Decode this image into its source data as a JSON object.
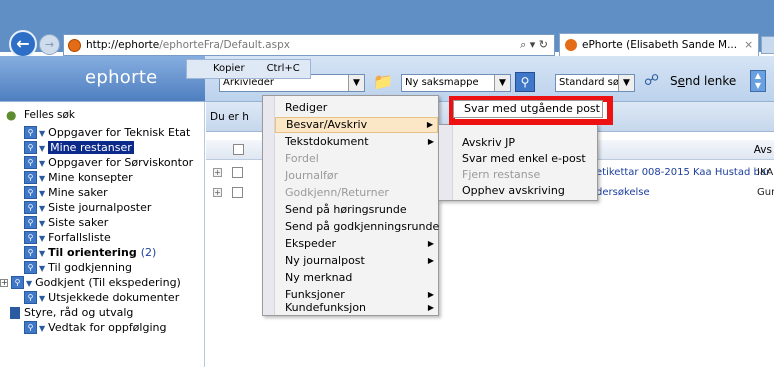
{
  "browser": {
    "url_host": "http://ephorte",
    "url_path": "/ephorteFra/Default.aspx",
    "address_controls": "⌕ ▾ ↻",
    "tab_title": "ePhorte (Elisabeth Sande M...",
    "tab_close": "×"
  },
  "tooltip": {
    "label": "Kopier",
    "shortcut": "Ctrl+C"
  },
  "app": {
    "logo": "ephorte",
    "role_combo": "Arkivleder",
    "mappe_combo": "Ny saksmappe",
    "search_combo": "Standard søk",
    "send_link_pre": "S",
    "send_link_ul": "e",
    "send_link_post": "nd lenke"
  },
  "leftnav": {
    "felles_sok": "Felles søk",
    "items": [
      {
        "label": "Oppgaver for Teknisk Etat"
      },
      {
        "label": "Mine restanser"
      },
      {
        "label": "Oppgaver for Sørviskontor"
      },
      {
        "label": "Mine konsepter"
      },
      {
        "label": "Mine saker"
      },
      {
        "label": "Siste journalposter"
      },
      {
        "label": "Siste saker"
      },
      {
        "label": "Forfallsliste"
      },
      {
        "label": "Til orientering",
        "count": "(2)"
      },
      {
        "label": "Til godkjenning"
      },
      {
        "label": "Godkjent (Til ekspedering)"
      },
      {
        "label": "Utsjekkede dokumenter"
      },
      {
        "label": "Styre, råd og utvalg"
      },
      {
        "label": "Vedtak for oppfølging"
      }
    ]
  },
  "main": {
    "info_bar": "Du er h",
    "col_avs": "Avs",
    "rows": [
      {
        "text": "etikettar 008-2015 Kaa Hustad bar",
        "suffix": "IKA"
      },
      {
        "text": "dersøkelse",
        "suffix": "Gur"
      }
    ]
  },
  "context_menu": {
    "items": [
      {
        "label": "Rediger"
      },
      {
        "label": "Besvar/Avskriv"
      },
      {
        "label": "Tekstdokument"
      },
      {
        "label": "Fordel"
      },
      {
        "label": "Journalfør"
      },
      {
        "label": "Godkjenn/Returner"
      },
      {
        "label": "Send på høringsrunde"
      },
      {
        "label": "Send på godkjenningsrunde"
      },
      {
        "label": "Ekspeder"
      },
      {
        "label": "Ny journalpost"
      },
      {
        "label": "Ny merknad"
      },
      {
        "label": "Funksjoner"
      },
      {
        "label": "Kundefunksjon"
      }
    ]
  },
  "submenu": {
    "highlighted": "Svar med utgående post",
    "items": [
      {
        "label": "Avskriv JP"
      },
      {
        "label": "Svar med enkel e-post"
      },
      {
        "label": "Fjern restanse"
      },
      {
        "label": "Opphev avskriving"
      }
    ]
  },
  "colors": {
    "highlight_box": "#ee1111",
    "selected_nav": "#0b2a8a",
    "menu_hover": "#fbe6c6"
  }
}
